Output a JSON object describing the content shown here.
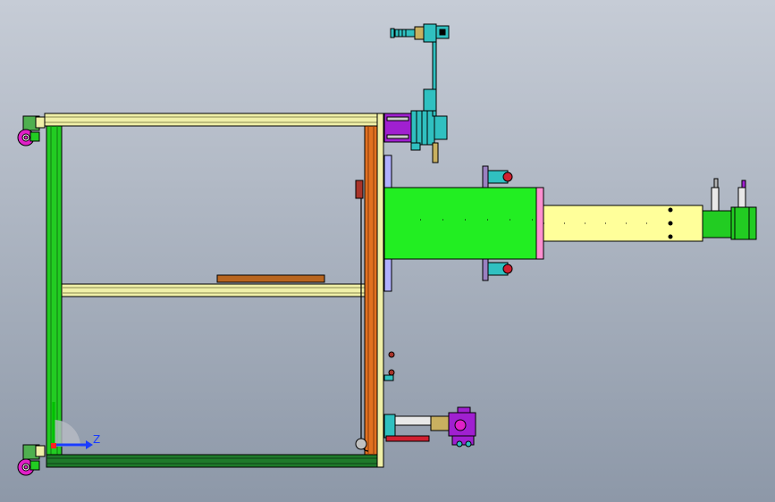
{
  "viewport": {
    "background_top": "#c6ccd6",
    "background_bottom": "#8d98a8"
  },
  "triad": {
    "z_label": "Z",
    "y_color": "#00c000",
    "z_color": "#1a3cff"
  },
  "colors": {
    "frame_green": "#22cc22",
    "frame_dark_green": "#1f7a2a",
    "frame_yellow": "#f0f0a8",
    "frame_orange": "#e07020",
    "plate_brown": "#b8651e",
    "cylinder_green": "#22ee22",
    "rod_yellow": "#ffff9a",
    "motor_purple": "#a020d0",
    "wheel_magenta": "#e020c8",
    "cyan_part": "#30c0c0",
    "pink_part": "#ff8fd0"
  }
}
